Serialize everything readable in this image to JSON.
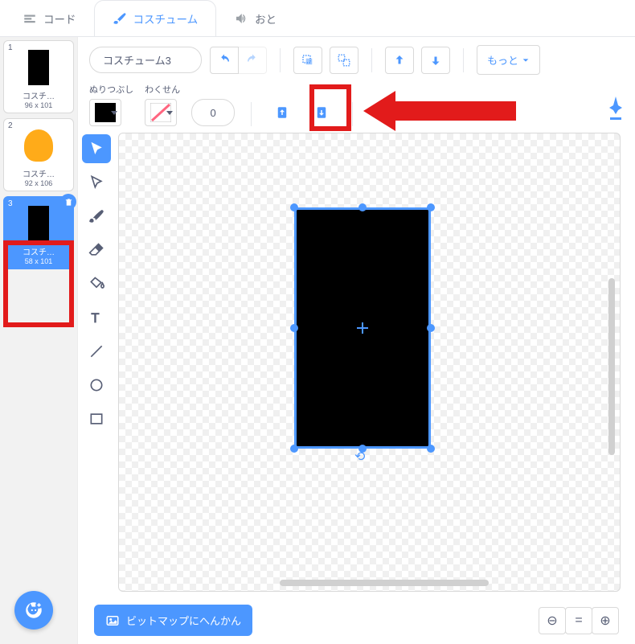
{
  "tabs": {
    "code": "コード",
    "costumes": "コスチューム",
    "sounds": "おと"
  },
  "costumes": [
    {
      "index": "1",
      "name": "コスチ…",
      "dim": "96 x 101",
      "type": "black"
    },
    {
      "index": "2",
      "name": "コスチ…",
      "dim": "92 x 106",
      "type": "cat"
    },
    {
      "index": "3",
      "name": "コスチ…",
      "dim": "58 x 101",
      "type": "black"
    }
  ],
  "toolbar": {
    "name_value": "コスチューム3",
    "more_label": "もっと",
    "fill_label": "ぬりつぶし",
    "stroke_label": "わくせん",
    "stroke_width": "0"
  },
  "bottom": {
    "bitmap_label": "ビットマップにへんかん"
  },
  "zoom": {
    "out": "⊖",
    "fit": "=",
    "in": "⊕"
  }
}
